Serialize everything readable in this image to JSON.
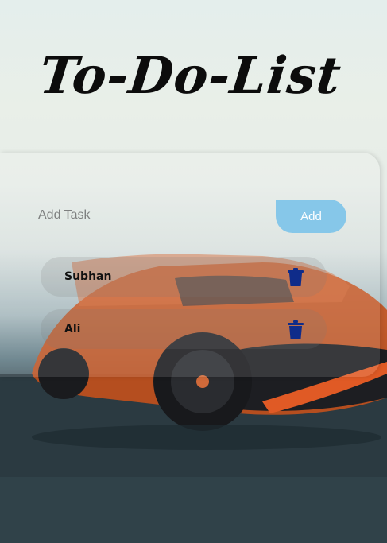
{
  "app": {
    "title": "To-Do-List"
  },
  "form": {
    "input_placeholder": "Add Task",
    "input_value": "",
    "add_label": "Add"
  },
  "tasks": [
    {
      "text": "Subhan",
      "delete_icon": "trash-icon"
    },
    {
      "text": "Ali",
      "delete_icon": "trash-icon"
    }
  ],
  "colors": {
    "accent": "#86c7e9",
    "trash": "#0f2c8a",
    "title": "#0c0c0c"
  }
}
